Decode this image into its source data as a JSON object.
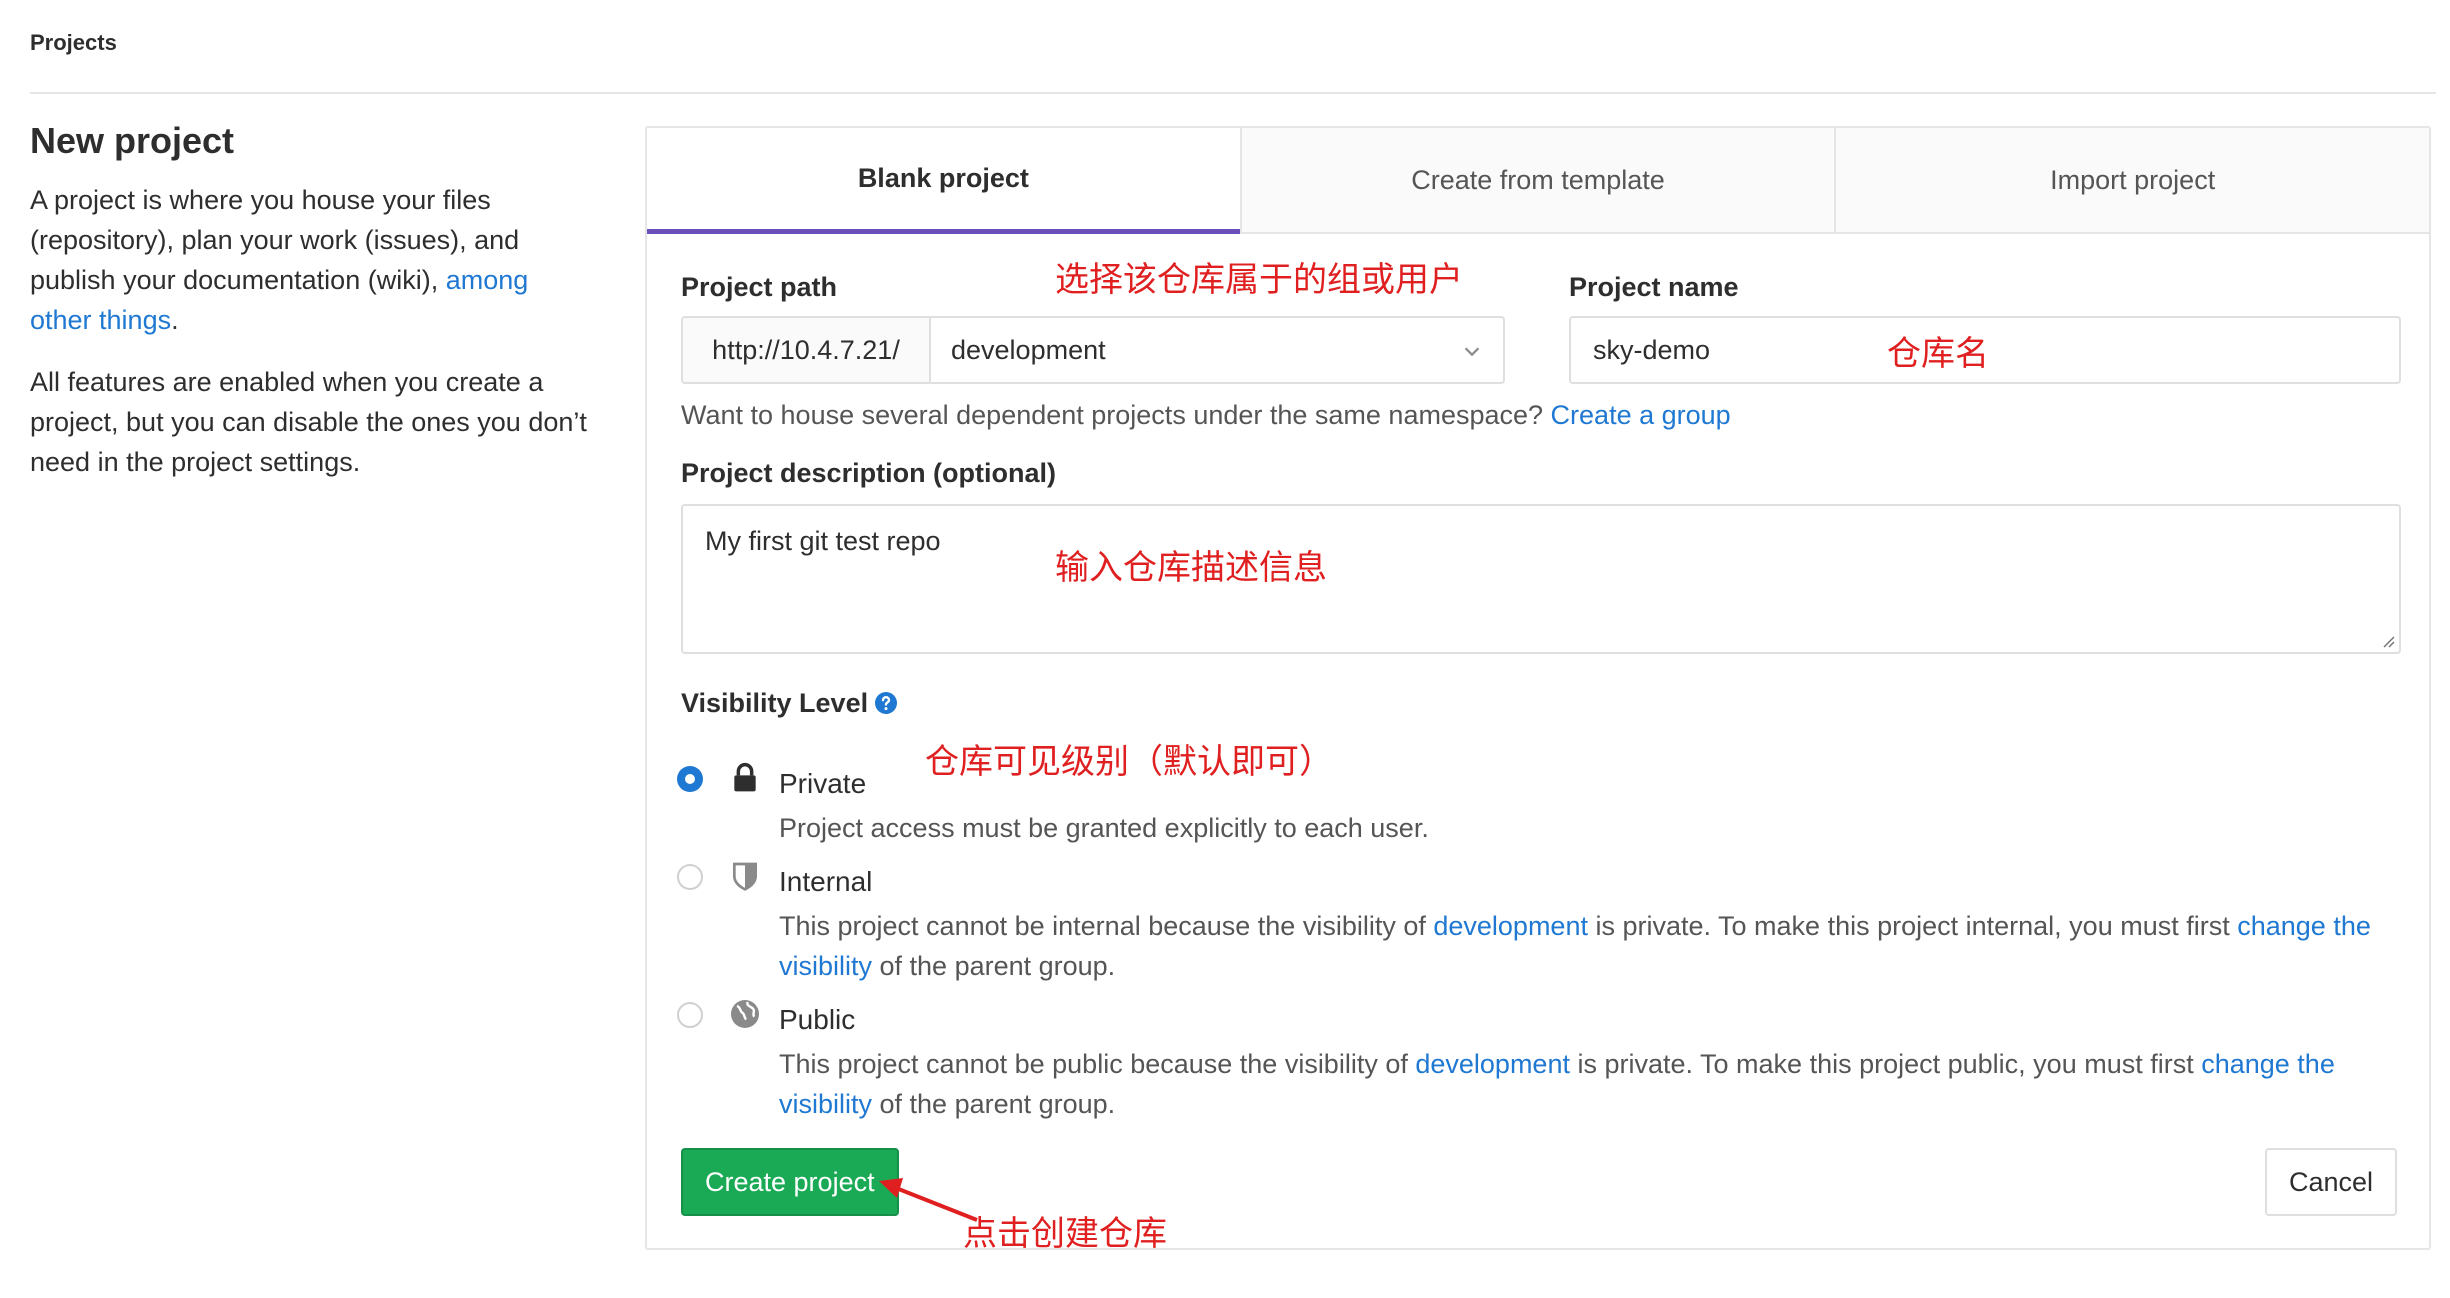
{
  "breadcrumb": "Projects",
  "intro": {
    "title": "New project",
    "para1_text": "A project is where you house your files (repository), plan your work (issues), and publish your documentation (wiki), ",
    "para1_link": "among other things",
    "para1_end": ".",
    "para2": "All features are enabled when you create a project, but you can disable the ones you don’t need in the project settings."
  },
  "tabs": [
    {
      "label": "Blank project",
      "active": true
    },
    {
      "label": "Create from template",
      "active": false
    },
    {
      "label": "Import project",
      "active": false
    }
  ],
  "form": {
    "project_path_label": "Project path",
    "path_prefix": "http://10.4.7.21/",
    "namespace_value": "development",
    "project_name_label": "Project name",
    "project_name_value": "sky-demo",
    "namespace_help": "Want to house several dependent projects under the same namespace? ",
    "namespace_help_link": "Create a group",
    "description_label": "Project description (optional)",
    "description_value": "My first git test repo",
    "visibility_label": "Visibility Level",
    "visibility": {
      "private": {
        "title": "Private",
        "desc": "Project access must be granted explicitly to each user.",
        "checked": true,
        "icon": "lock-icon"
      },
      "internal": {
        "title": "Internal",
        "desc_1": "This project cannot be internal because the visibility of ",
        "desc_link1": "development",
        "desc_2": " is private. To make this project internal, you must first ",
        "desc_link2": "change the visibility",
        "desc_3": " of the parent group.",
        "checked": false,
        "icon": "shield-icon"
      },
      "public": {
        "title": "Public",
        "desc_1": "This project cannot be public because the visibility of ",
        "desc_link1": "development",
        "desc_2": " is private. To make this project public, you must first ",
        "desc_link2": "change the visibility",
        "desc_3": " of the parent group.",
        "checked": false,
        "icon": "globe-icon"
      }
    },
    "create_label": "Create project",
    "cancel_label": "Cancel"
  },
  "annotations": {
    "path": "选择该仓库属于的组或用户",
    "name": "仓库名",
    "description": "输入仓库描述信息",
    "visibility": "仓库可见级别（默认即可）",
    "create": "点击创建仓库"
  },
  "colors": {
    "link": "#1f78d1",
    "create_button": "#1aaa55",
    "active_tab_border": "#6b4fbb",
    "annotation": "#e02020"
  }
}
